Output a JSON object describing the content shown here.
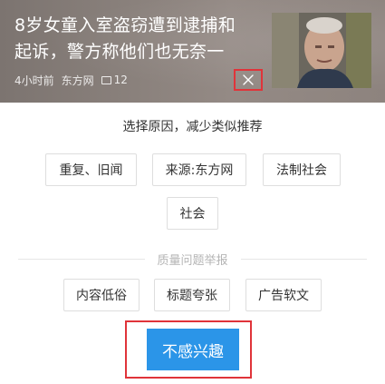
{
  "news": {
    "title": "8岁女童入室盗窃遭到逮捕和起诉，警方称他们也无奈一",
    "time": "4小时前",
    "source": "东方网",
    "comment_icon": "comment-icon",
    "comments": "12",
    "close_icon": "close-icon"
  },
  "panel": {
    "prompt": "选择原因，减少类似推荐",
    "reasons": [
      "重复、旧闻",
      "来源:东方网",
      "法制社会",
      "社会"
    ],
    "quality_label": "质量问题举报",
    "quality_reasons": [
      "内容低俗",
      "标题夸张",
      "广告软文"
    ],
    "dislike_label": "不感兴趣"
  },
  "colors": {
    "accent_blue": "#2b95e8",
    "highlight_red": "#e0343a"
  }
}
